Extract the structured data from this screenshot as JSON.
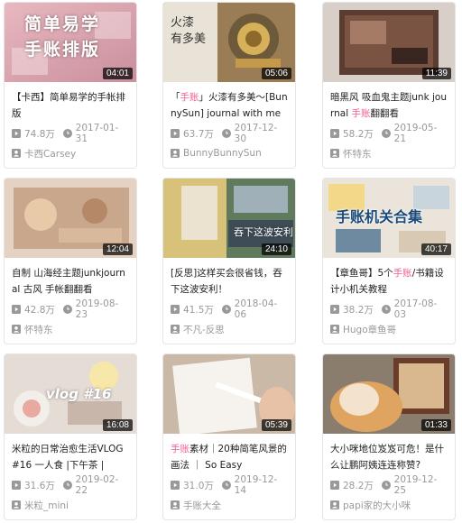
{
  "videos": [
    {
      "duration": "04:01",
      "title_pre": "【卡西】简单易学的手帐排版",
      "title_hl": "",
      "title_post": "",
      "views": "74.8万",
      "date": "2017-01-31",
      "author": "卡西Carsey",
      "overlay": "简单易学\n手账排版"
    },
    {
      "duration": "05:06",
      "title_pre": "「",
      "title_hl": "手账",
      "title_post": "」火漆有多美～[BunnySun] journal with me",
      "views": "63.7万",
      "date": "2017-12-30",
      "author": "BunnyBunnySun",
      "overlay": "火漆\n有多美"
    },
    {
      "duration": "11:39",
      "title_pre": "暗黑风 吸血鬼主题junk journal ",
      "title_hl": "手账",
      "title_post": "翻翻看",
      "views": "58.2万",
      "date": "2019-05-21",
      "author": "怀特东",
      "overlay": ""
    },
    {
      "duration": "12:04",
      "title_pre": "自制 山海经主题junkjournal 古风 手帐翻翻看",
      "title_hl": "",
      "title_post": "",
      "views": "42.8万",
      "date": "2019-08-23",
      "author": "怀特东",
      "overlay": ""
    },
    {
      "duration": "24:10",
      "title_pre": "[反思]这样买会很省钱，吞下这波安利！",
      "title_hl": "",
      "title_post": "",
      "views": "41.5万",
      "date": "2018-04-06",
      "author": "不凡-反思",
      "overlay": "吞下这波安利"
    },
    {
      "duration": "40:17",
      "title_pre": "【章鱼哥】5个",
      "title_hl": "手账",
      "title_post": "/书籍设计小机关教程",
      "views": "38.2万",
      "date": "2017-08-03",
      "author": "Hugo章鱼哥",
      "overlay": "手账机关合集"
    },
    {
      "duration": "16:08",
      "title_pre": "米粒的日常治愈生活VLOG#16 一人食 |下午茶 |",
      "title_hl": "",
      "title_post": "",
      "views": "31.6万",
      "date": "2019-02-22",
      "author": "米粒_mini",
      "overlay": "vlog #16"
    },
    {
      "duration": "05:39",
      "title_pre": "",
      "title_hl": "手账",
      "title_post": "素材｜20种简笔风景的画法 ｜ So Easy",
      "views": "31.0万",
      "date": "2019-12-14",
      "author": "手账大全",
      "overlay": ""
    },
    {
      "duration": "01:33",
      "title_pre": "大小咪地位岌岌可危！是什么让鹏阿姨连连称赞?",
      "title_hl": "",
      "title_post": "",
      "views": "28.2万",
      "date": "2019-12-25",
      "author": "papi家的大小咪",
      "overlay": ""
    }
  ],
  "colors": {
    "highlight": "#f25d8e",
    "meta": "#999999",
    "border": "#e5e5e5"
  },
  "icons": {
    "views": "play-count-icon",
    "date": "clock-icon",
    "author": "uploader-icon"
  }
}
